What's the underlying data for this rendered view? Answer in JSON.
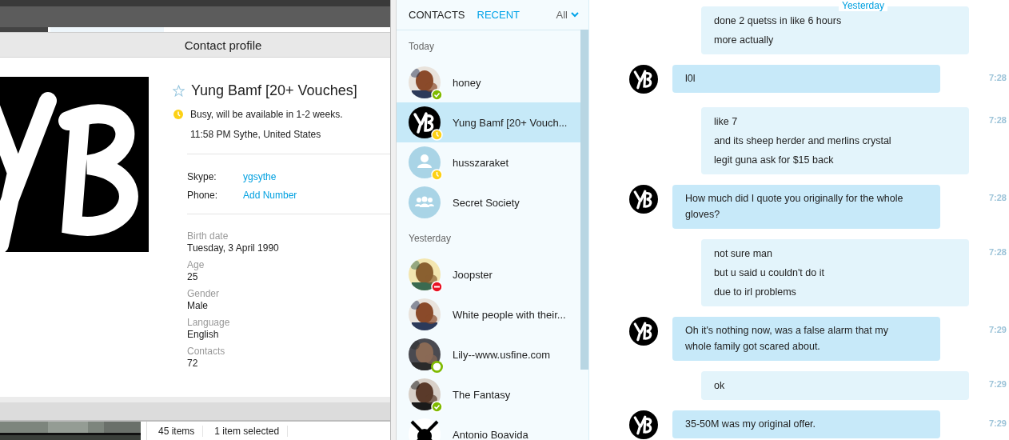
{
  "background_window": {
    "status_bar": {
      "items_count": "45 items",
      "selection": "1 item selected"
    }
  },
  "profile_window": {
    "title": "Contact profile",
    "name": "Yung Bamf [20+ Vouches]",
    "favorite": false,
    "status_badge": {
      "kind": "away",
      "color": "#fcd116"
    },
    "mood": "Busy, will be available in 1-2 weeks.",
    "local_time": "11:58 PM Sythe, United States",
    "contact_fields": [
      {
        "label": "Skype:",
        "value": "ygsythe"
      },
      {
        "label": "Phone:",
        "value": "Add Number"
      }
    ],
    "details": [
      {
        "label": "Birth date",
        "value": "Tuesday, 3 April 1990"
      },
      {
        "label": "Age",
        "value": "25"
      },
      {
        "label": "Gender",
        "value": "Male"
      },
      {
        "label": "Language",
        "value": "English"
      },
      {
        "label": "Contacts",
        "value": "72"
      }
    ]
  },
  "contact_list": {
    "tabs": [
      {
        "label": "CONTACTS",
        "selected": false
      },
      {
        "label": "RECENT",
        "selected": true
      }
    ],
    "filter": "All",
    "sections": [
      {
        "heading": "Today",
        "contacts": [
          {
            "name": "honey",
            "kind": "picture",
            "badge": {
              "kind": "online",
              "color": "#7fba00"
            },
            "selected": false
          },
          {
            "name": "Yung Bamf [20+ Vouch...",
            "kind": "logo",
            "badge": {
              "kind": "away",
              "color": "#fcd116"
            },
            "selected": true
          },
          {
            "name": "husszaraket",
            "kind": "person",
            "badge": {
              "kind": "away",
              "color": "#fcd116"
            },
            "selected": false
          },
          {
            "name": "Secret Society",
            "kind": "group",
            "selected": false
          }
        ]
      },
      {
        "heading": "Yesterday",
        "contacts": [
          {
            "name": "Joopster",
            "kind": "picture",
            "badge": {
              "kind": "busy",
              "color": "#e81123"
            },
            "selected": false
          },
          {
            "name": "White people with their...",
            "kind": "picture",
            "selected": false
          },
          {
            "name": "Lily--www.usfine.com",
            "kind": "picture",
            "badge": {
              "kind": "offline",
              "color": "#7fba00"
            },
            "selected": false
          },
          {
            "name": "The Fantasy",
            "kind": "picture",
            "badge": {
              "kind": "online",
              "color": "#7fba00"
            },
            "selected": false
          },
          {
            "name": "Antonio Boavida",
            "kind": "pattern",
            "selected": false
          }
        ]
      }
    ]
  },
  "chat": {
    "date_label": "Yesterday",
    "messages": [
      {
        "kind": "outgoing",
        "lines": [
          "done 2 quetss in like 6 hours",
          "more actually"
        ]
      },
      {
        "kind": "incoming",
        "text": "l0l",
        "time": "7:28"
      },
      {
        "kind": "outgoing",
        "lines": [
          "like 7",
          "and its sheep herder and merlins crystal",
          "legit guna ask for $15 back"
        ],
        "time": "7:28"
      },
      {
        "kind": "incoming",
        "text": "How much did I quote you originally for the whole gloves?",
        "time": "7:28"
      },
      {
        "kind": "outgoing",
        "lines": [
          "not sure man",
          "but u said u couldn't do it",
          "due to irl problems"
        ],
        "time": "7:28"
      },
      {
        "kind": "incoming",
        "text": "Oh it's nothing now, was a false alarm that my whole family got scared about.",
        "time": "7:29"
      },
      {
        "kind": "outgoing",
        "lines": [
          "ok"
        ],
        "time": "7:29"
      },
      {
        "kind": "incoming",
        "text": "35-50M was my original offer.",
        "time": "7:29"
      }
    ]
  }
}
